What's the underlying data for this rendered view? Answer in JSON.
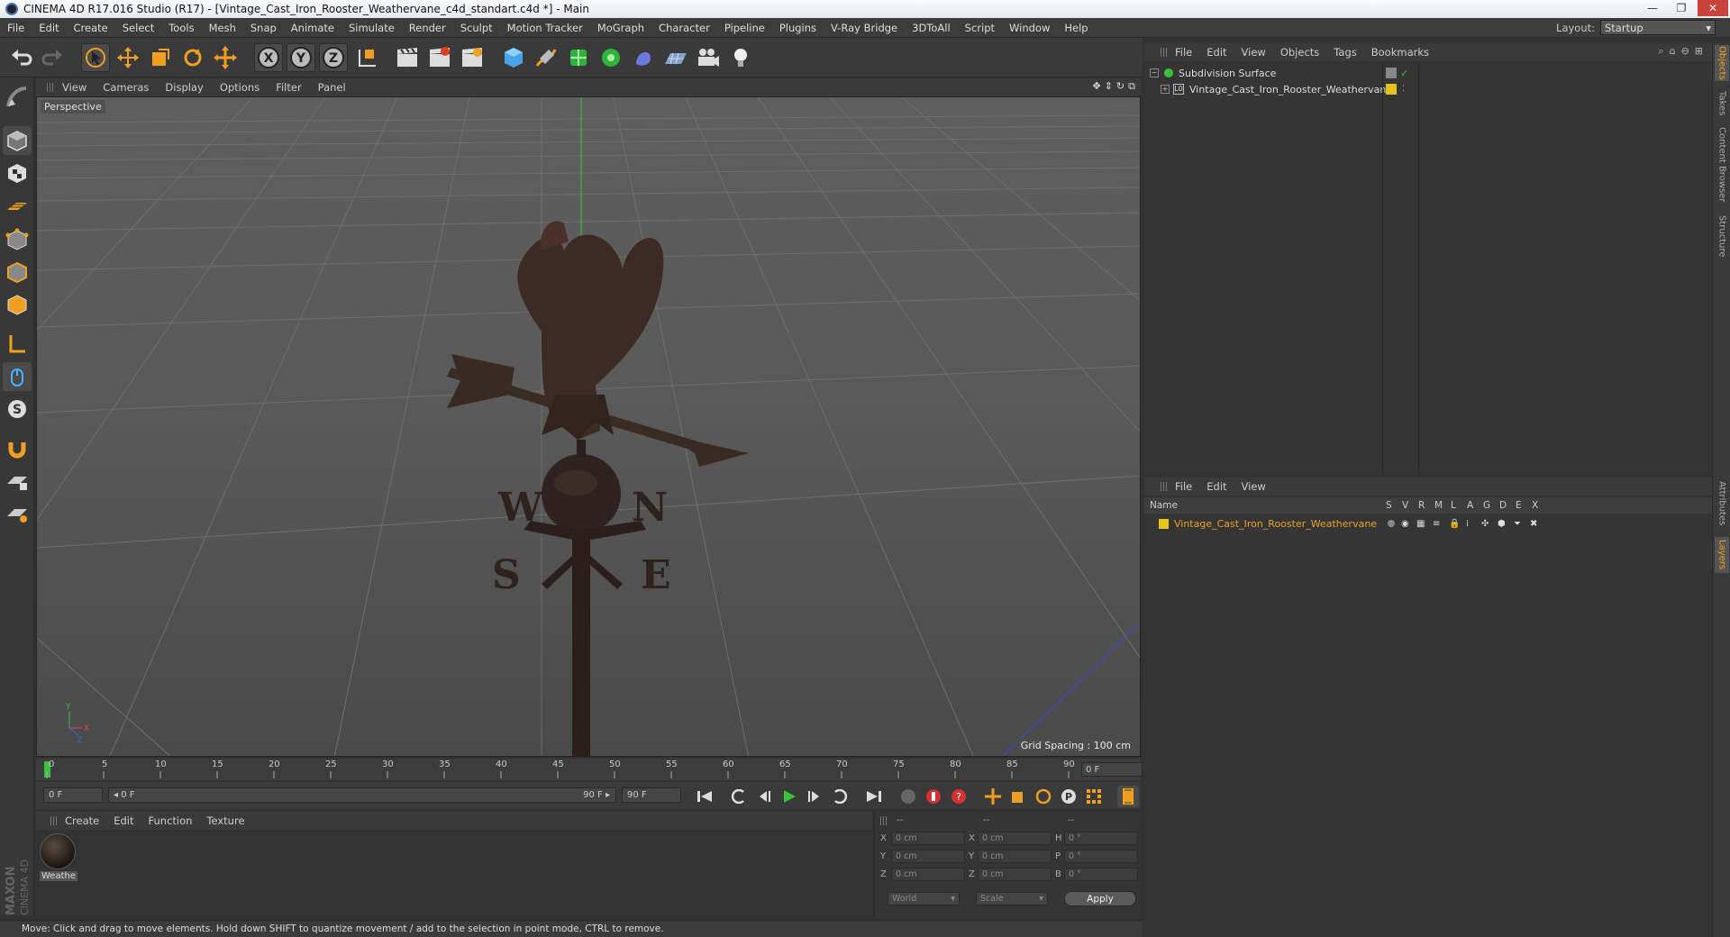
{
  "window": {
    "title": "CINEMA 4D R17.016 Studio (R17) - [Vintage_Cast_Iron_Rooster_Weathervane_c4d_standart.c4d *] - Main",
    "minimize": "—",
    "maximize": "❐",
    "close": "✕"
  },
  "menubar": {
    "items": [
      "File",
      "Edit",
      "Create",
      "Select",
      "Tools",
      "Mesh",
      "Snap",
      "Animate",
      "Simulate",
      "Render",
      "Sculpt",
      "Motion Tracker",
      "MoGraph",
      "Character",
      "Pipeline",
      "Plugins",
      "V-Ray Bridge",
      "3DToAll",
      "Script",
      "Window",
      "Help"
    ],
    "layout_label": "Layout:",
    "layout_value": "Startup"
  },
  "viewport": {
    "menu": [
      "View",
      "Cameras",
      "Display",
      "Options",
      "Filter",
      "Panel"
    ],
    "camera_label": "Perspective",
    "grid_spacing": "Grid Spacing : 100 cm",
    "compass": {
      "w": "W",
      "n": "N",
      "s": "S",
      "e": "E"
    },
    "axis": {
      "y": "Y",
      "x": "X",
      "z": "Z"
    }
  },
  "timeline": {
    "ticks": [
      "0",
      "5",
      "10",
      "15",
      "20",
      "25",
      "30",
      "35",
      "40",
      "45",
      "50",
      "55",
      "60",
      "65",
      "70",
      "75",
      "80",
      "85",
      "90"
    ],
    "current_frame": "0 F",
    "start_field": "0 F",
    "range_start": "◂ 0 F",
    "range_end": "90 F ▸",
    "end_field": "90 F"
  },
  "material_manager": {
    "menu": [
      "Create",
      "Edit",
      "Function",
      "Texture"
    ],
    "materials": [
      {
        "name": "Weathe"
      }
    ]
  },
  "coordinates": {
    "header": [
      "--",
      "--",
      "--"
    ],
    "rows": [
      {
        "l1": "X",
        "v1": "0 cm",
        "l2": "X",
        "v2": "0 cm",
        "l3": "H",
        "v3": "0 °"
      },
      {
        "l1": "Y",
        "v1": "0 cm",
        "l2": "Y",
        "v2": "0 cm",
        "l3": "P",
        "v3": "0 °"
      },
      {
        "l1": "Z",
        "v1": "0 cm",
        "l2": "Z",
        "v2": "0 cm",
        "l3": "B",
        "v3": "0 °"
      }
    ],
    "world": "World",
    "scale": "Scale",
    "apply": "Apply"
  },
  "status": {
    "text": "Move: Click and drag to move elements. Hold down SHIFT to quantize movement / add to the selection in point mode, CTRL to remove."
  },
  "branding": {
    "maxon": "MAXON",
    "cinema": "CINEMA 4D"
  },
  "object_manager": {
    "menu": [
      "File",
      "Edit",
      "View",
      "Objects",
      "Tags",
      "Bookmarks"
    ],
    "objects": [
      {
        "name": "Subdivision Surface"
      },
      {
        "name": "Vintage_Cast_Iron_Rooster_Weathervane"
      }
    ]
  },
  "layer_manager": {
    "menu": [
      "File",
      "Edit",
      "View"
    ],
    "columns": [
      "Name",
      "S",
      "V",
      "R",
      "M",
      "L",
      "A",
      "G",
      "D",
      "E",
      "X"
    ],
    "layers": [
      {
        "name": "Vintage_Cast_Iron_Rooster_Weathervane",
        "color": "#e8c31a"
      }
    ]
  },
  "right_tabs": [
    "Objects",
    "Takes",
    "Content Browser",
    "Structure",
    "Attributes",
    "Layers"
  ],
  "colors": {
    "accent": "#f0a020",
    "layer_yellow": "#e8c31a",
    "green": "#3ac23a"
  }
}
